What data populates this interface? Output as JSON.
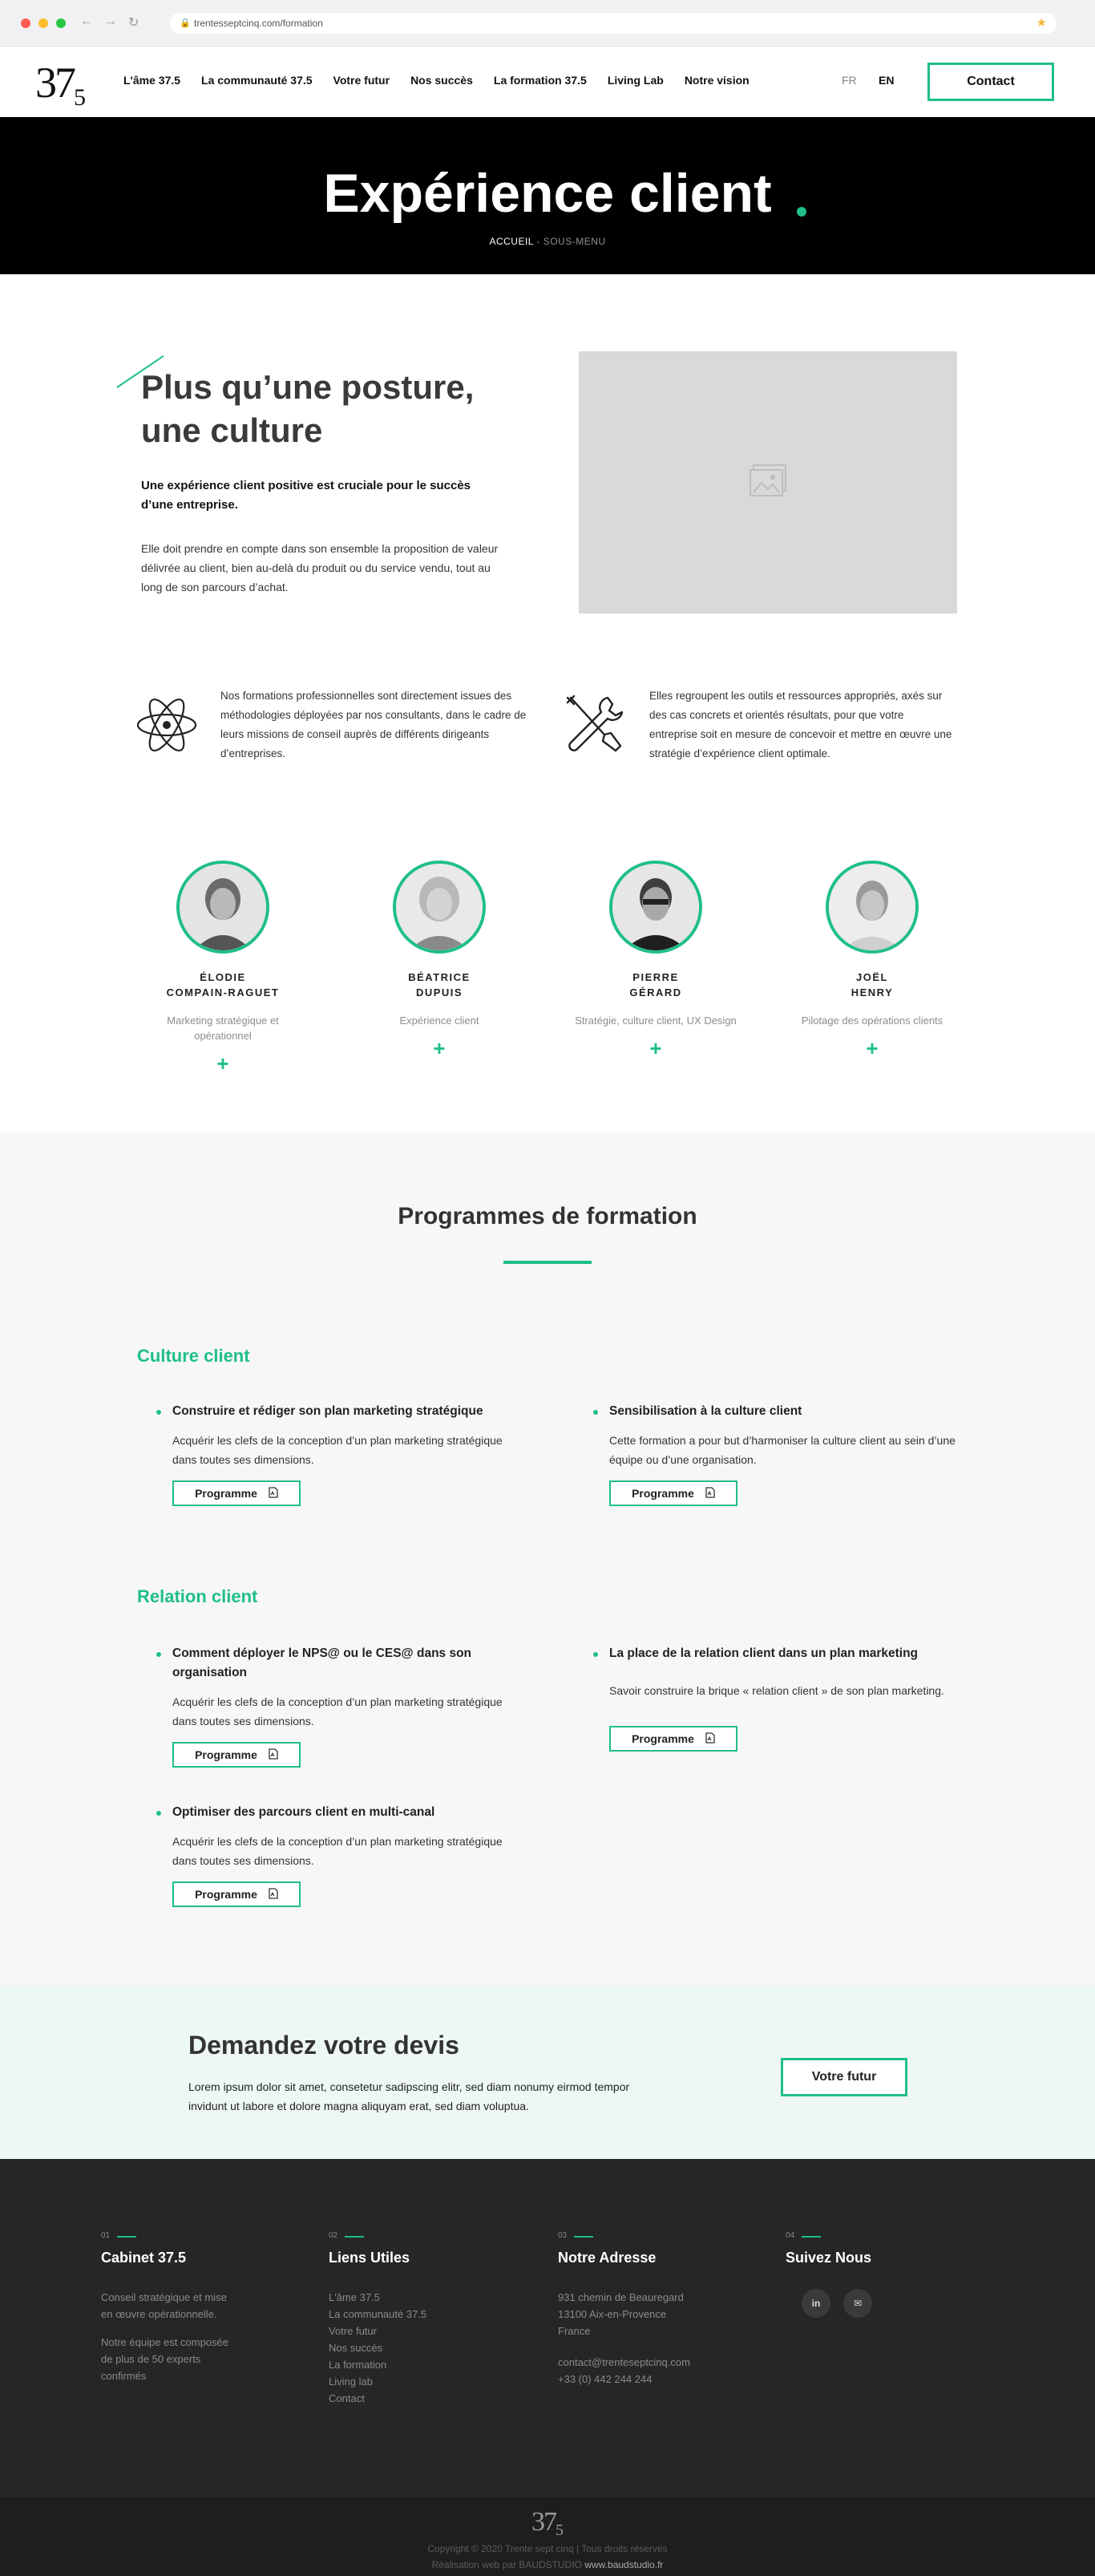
{
  "browser": {
    "url": "trentesseptcinq.com/formation"
  },
  "header": {
    "logo_main": "37",
    "logo_sub": "5",
    "nav": [
      "L'âme 37.5",
      "La communauté 37.5",
      "Votre futur",
      "Nos  succès",
      "La formation 37.5",
      "Living Lab",
      "Notre vision"
    ],
    "lang_fr": "FR",
    "lang_en": "EN",
    "contact_label": "Contact"
  },
  "hero": {
    "title": "Expérience client",
    "breadcrumb_home": "ACCUEIL",
    "breadcrumb_sep": " - ",
    "breadcrumb_current": "SOUS-MENU"
  },
  "intro": {
    "title": "Plus qu’une posture, une culture",
    "lead": "Une expérience client positive est cruciale pour le succès d’une entreprise.",
    "text": "Elle doit prendre en compte dans son ensemble la proposition de valeur délivrée au client, bien au-delà du produit ou du service vendu, tout au long de son parcours d’achat."
  },
  "features": [
    {
      "icon": "atom-icon",
      "text": "Nos formations professionnelles sont directement issues des méthodologies déployées par nos consultants, dans le cadre de leurs missions de conseil auprès de différents dirigeants d’entreprises."
    },
    {
      "icon": "tools-icon",
      "text": "Elles regroupent les outils et ressources appropriés, axés sur des cas concrets et orientés résultats, pour que votre entreprise soit en mesure de concevoir et mettre en œuvre une stratégie d’expérience client optimale."
    }
  ],
  "team": [
    {
      "name_line1": "ÉLODIE",
      "name_line2": "COMPAIN-RAGUET",
      "role": "Marketing stratégique et opérationnel",
      "plus": "+"
    },
    {
      "name_line1": "BÉATRICE",
      "name_line2": "DUPUIS",
      "role": "Expérience client",
      "plus": "+"
    },
    {
      "name_line1": "PIERRE",
      "name_line2": "GÉRARD",
      "role": "Stratégie, culture client, UX Design",
      "plus": "+"
    },
    {
      "name_line1": "JOËL",
      "name_line2": "HENRY",
      "role": "Pilotage des opérations clients",
      "plus": "+"
    }
  ],
  "programmes": {
    "title": "Programmes de formation",
    "button_label": "Programme",
    "categories": [
      {
        "title": "Culture client",
        "courses": [
          {
            "title": "Construire et rédiger son plan marketing stratégique",
            "desc": "Acquérir les clefs de la conception d’un plan marketing stratégique dans toutes ses dimensions."
          },
          {
            "title": "Sensibilisation à la culture client",
            "desc": "Cette formation a pour but d’harmoniser la culture client au sein d’une équipe ou d’une organisation."
          }
        ]
      },
      {
        "title": "Relation client",
        "courses": [
          {
            "title": "Comment déployer le NPS@ ou le CES@ dans son organisation",
            "desc": "Acquérir les clefs de la conception d’un plan marketing stratégique dans toutes ses dimensions."
          },
          {
            "title": "La place de la relation client dans un plan marketing",
            "desc": "Savoir construire la brique « relation client » de son plan marketing."
          },
          {
            "title": "Optimiser des parcours client en multi-canal",
            "desc": "Acquérir les clefs de la conception d’un plan marketing stratégique dans toutes ses dimensions."
          }
        ]
      }
    ]
  },
  "cta": {
    "title": "Demandez votre devis",
    "text": "Lorem ipsum dolor sit amet, consetetur sadipscing elitr, sed diam nonumy eirmod tempor invidunt ut labore et dolore magna aliquyam erat, sed diam voluptua.",
    "button": "Votre futur"
  },
  "footer": {
    "col1": {
      "num": "01",
      "title": "Cabinet 37.5",
      "text1": "Conseil stratégique et mise en œuvre opérationnelle.",
      "text2": "Notre équipe est composée de plus de 50 experts confirmés"
    },
    "col2": {
      "num": "02",
      "title": "Liens Utiles",
      "links": [
        "L'âme 37.5",
        "La communauté 37.5",
        "Votre futur",
        "Nos succès",
        "La formation",
        "Living lab",
        "Contact"
      ]
    },
    "col3": {
      "num": "03",
      "title": "Notre Adresse",
      "address1": "931 chemin de Beauregard",
      "address2": "13100 Aix-en-Provence",
      "address3": "France",
      "email": "contact@trenteseptcinq.com",
      "phone": "+33 (0) 442 244 244"
    },
    "col4": {
      "num": "04",
      "title": "Suivez Nous",
      "social1": "in",
      "social2": "✉"
    },
    "copyright": "Copyright © 2020 Trente sept cinq | Tous droits réservés",
    "credit": "Réalisation web par BAUDSTUDIO",
    "credit_site": "www.baudstudio.fr"
  },
  "colors": {
    "accent": "#1fbf87",
    "hero_bg": "#000000",
    "footer_bg": "#262626"
  }
}
